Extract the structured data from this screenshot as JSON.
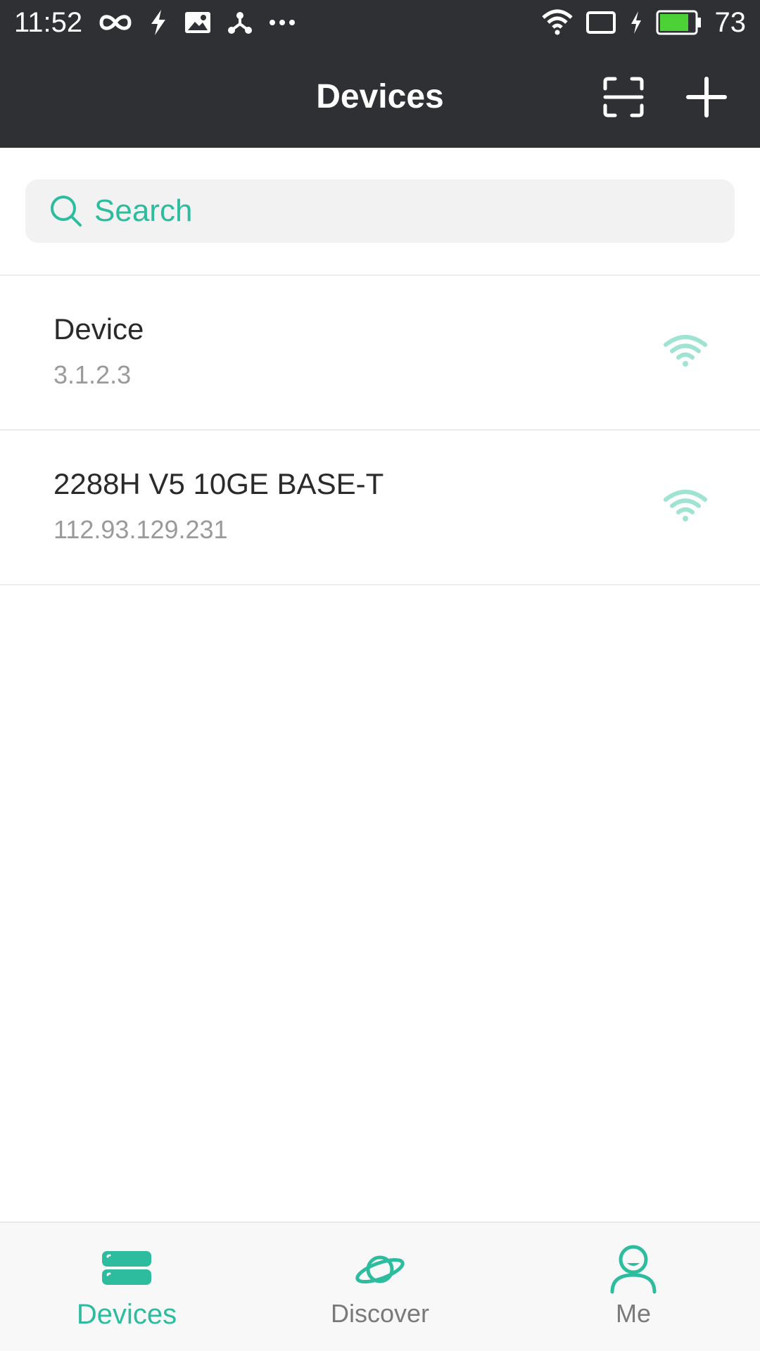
{
  "status_bar": {
    "time": "11:52",
    "battery_level": "73",
    "icons_left": [
      "infinity-icon",
      "flash-icon",
      "image-icon",
      "share-icon",
      "more-dots-icon"
    ],
    "icons_right": [
      "wifi-icon",
      "cast-icon",
      "charging-icon",
      "battery-icon"
    ]
  },
  "app_bar": {
    "title": "Devices",
    "actions": [
      "scan-icon",
      "add-icon"
    ]
  },
  "search": {
    "placeholder": "Search"
  },
  "devices": [
    {
      "name": "Device",
      "address": "3.1.2.3",
      "status_icon": "wifi-icon"
    },
    {
      "name": "2288H V5 10GE BASE-T",
      "address": "112.93.129.231",
      "status_icon": "wifi-icon"
    }
  ],
  "bottom_nav": {
    "tabs": [
      {
        "label": "Devices",
        "icon": "server-icon",
        "active": true
      },
      {
        "label": "Discover",
        "icon": "planet-icon",
        "active": false
      },
      {
        "label": "Me",
        "icon": "person-icon",
        "active": false
      }
    ]
  },
  "colors": {
    "accent": "#2ebc9f",
    "header_bg": "#2f3033",
    "wifi_light": "#9fe3d2"
  }
}
